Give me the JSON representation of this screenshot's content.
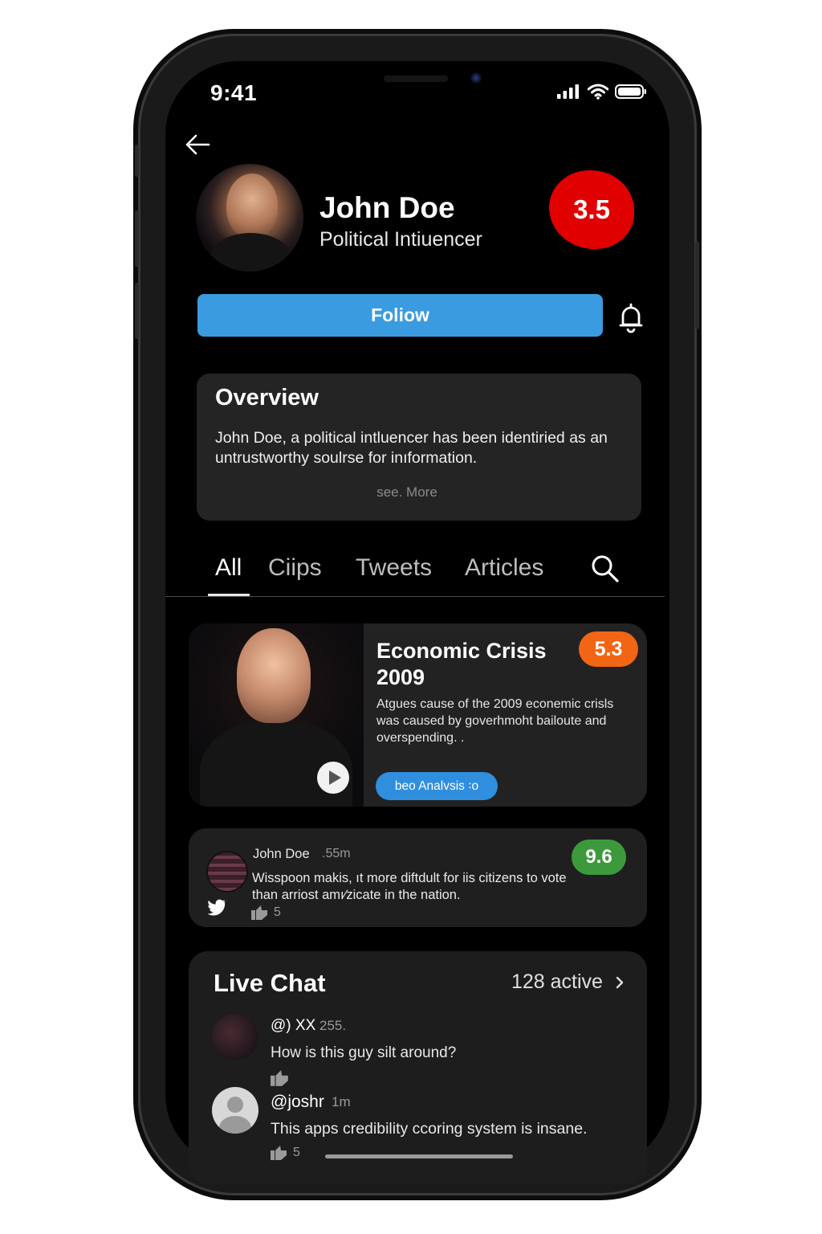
{
  "status_bar": {
    "time": "9:41"
  },
  "profile": {
    "name": "John Doe",
    "role": "Political Intiuencer",
    "score": "3.5",
    "follow_label": "Foliow"
  },
  "overview": {
    "title": "Overview",
    "text": "John Doe, a political intluencer has been identiried as an untrustworthy soulrse for inıformation.",
    "more_label": "see. More"
  },
  "tabs": [
    {
      "label": "All",
      "active": true
    },
    {
      "label": "Ciips",
      "active": false
    },
    {
      "label": "Tweets",
      "active": false
    },
    {
      "label": "Articles",
      "active": false
    }
  ],
  "clip_card": {
    "title": "Economic Crisis 2009",
    "score": "5.3",
    "text": "Atgues cause of the 2009 econemic crisls was caused by goverhmoht bailoute and overspending. .",
    "button_label": "beo Analvsis ꞉o"
  },
  "tweet_card": {
    "author": "John Doe",
    "time": ".55m",
    "text": "Wisspoon makis, ıt more diftdult for iis citizens to vote than arriost amı⁄zicate in the nation.",
    "score": "9.6",
    "likes": "5"
  },
  "live_chat": {
    "title": "Live Chat",
    "active_label": "128 active",
    "messages": [
      {
        "handle": "@) XX",
        "time": "255.",
        "text": "How is this guy silt around?"
      },
      {
        "handle": "@joshr",
        "time": "1m",
        "text": "This apps credibility ccoring system is insane.",
        "likes": "5"
      }
    ]
  },
  "colors": {
    "follow_blue": "#3a9be0",
    "score_red": "#e00000",
    "score_orange": "#f26515",
    "score_green": "#3c9a3c"
  },
  "icons": [
    "back-arrow-icon",
    "bell-icon",
    "search-icon",
    "play-icon",
    "twitter-bird-icon",
    "thumbs-up-icon",
    "chevron-right-icon",
    "signal-icon",
    "wifi-icon",
    "battery-icon"
  ]
}
